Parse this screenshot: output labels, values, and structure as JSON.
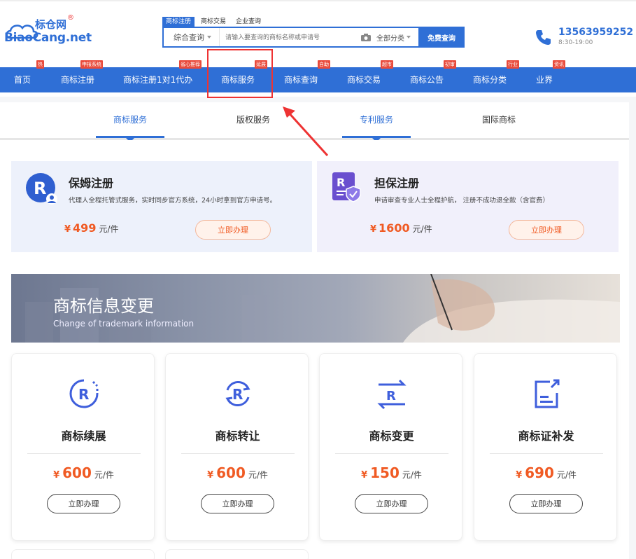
{
  "logo": {
    "cn": "标仓网",
    "reg": "®",
    "en": "BiaoCang.net"
  },
  "search": {
    "tabs": [
      "商标注册",
      "商标交易",
      "企业查询"
    ],
    "type_label": "综合查询",
    "placeholder": "请输入要查询的商标名称或申请号",
    "category_label": "全部分类",
    "button_label": "免费查询"
  },
  "contact": {
    "phone": "13563959252",
    "hours": "8:30-19:00"
  },
  "nav": {
    "items": [
      {
        "label": "首页",
        "badge": "热"
      },
      {
        "label": "商标注册",
        "badge": "申报系统"
      },
      {
        "label": "商标注册1对1代办",
        "badge": "省心推荐"
      },
      {
        "label": "商标服务",
        "badge": "延展"
      },
      {
        "label": "商标查询",
        "badge": "自助"
      },
      {
        "label": "商标交易",
        "badge": "超市"
      },
      {
        "label": "商标公告",
        "badge": "初审"
      },
      {
        "label": "商标分类",
        "badge": "行业"
      },
      {
        "label": "业界",
        "badge": "资讯"
      }
    ]
  },
  "service_tabs": [
    {
      "label": "商标服务",
      "active": true
    },
    {
      "label": "版权服务",
      "active": false
    },
    {
      "label": "专利服务",
      "active": true
    },
    {
      "label": "国际商标",
      "active": false
    }
  ],
  "featured": [
    {
      "title": "保姆注册",
      "desc": "代理人全程托管式服务，实时同步官方系统，24小时拿到官方申请号。",
      "currency": "¥",
      "price": "499",
      "unit": "元/件",
      "button": "立即办理",
      "bg": "#edf1fb"
    },
    {
      "title": "担保注册",
      "desc": "申请审查专业人士全程护航， 注册不成功退全款（含官费）",
      "currency": "¥",
      "price": "1600",
      "unit": "元/件",
      "button": "立即办理",
      "bg": "#f1f0fb"
    }
  ],
  "banner": {
    "title": "商标信息变更",
    "subtitle": "Change of trademark information"
  },
  "services": [
    {
      "title": "商标续展",
      "currency": "¥",
      "price": "600",
      "unit": "元/件",
      "button": "立即办理",
      "icon": "r-renew-icon"
    },
    {
      "title": "商标转让",
      "currency": "¥",
      "price": "600",
      "unit": "元/件",
      "button": "立即办理",
      "icon": "r-transfer-icon"
    },
    {
      "title": "商标变更",
      "currency": "¥",
      "price": "150",
      "unit": "元/件",
      "button": "立即办理",
      "icon": "r-change-icon"
    },
    {
      "title": "商标证补发",
      "currency": "¥",
      "price": "690",
      "unit": "元/件",
      "button": "立即办理",
      "icon": "certificate-reissue-icon"
    }
  ],
  "colors": {
    "brand_blue": "#2f6fd6",
    "price_orange": "#f05a23",
    "badge_red": "#e94b3c",
    "highlight_red": "#e33333"
  }
}
